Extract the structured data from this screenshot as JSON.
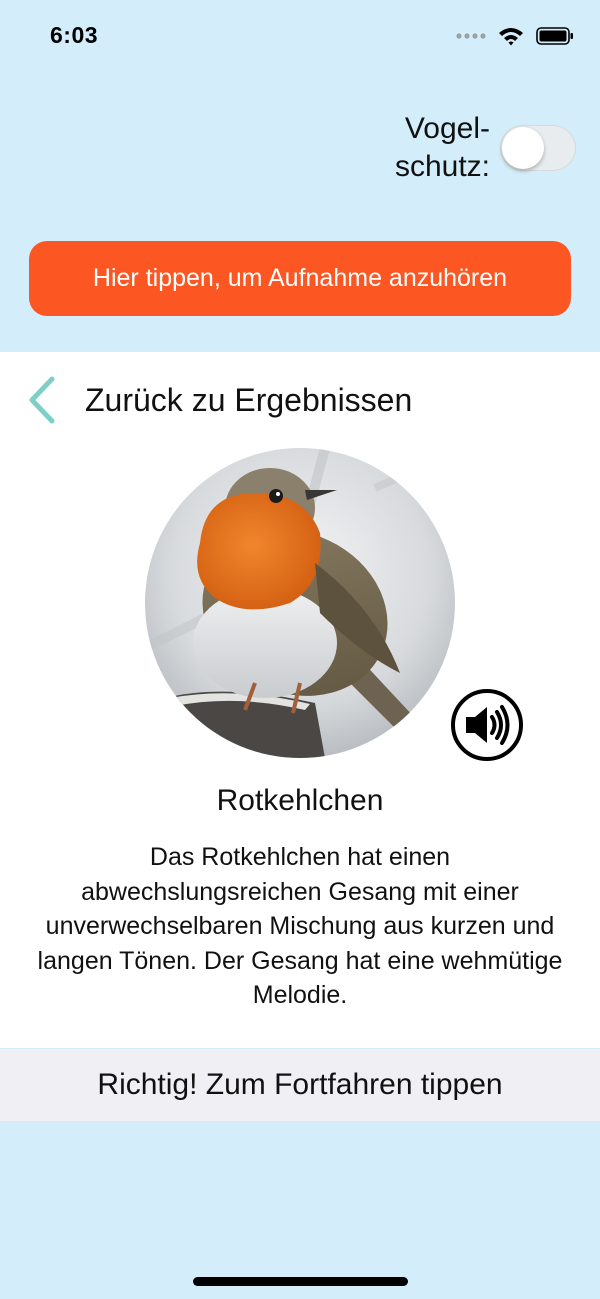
{
  "status": {
    "time": "6:03"
  },
  "settings": {
    "protection_label_line1": "Vogel-",
    "protection_label_line2": "schutz:",
    "protection_enabled": false
  },
  "player": {
    "record_label": "Hier tippen, um Aufnahme anzuhören"
  },
  "navigation": {
    "back_label": "Zurück zu Ergebnissen"
  },
  "bird": {
    "name": "Rotkehlchen",
    "description": "Das Rotkehlchen hat einen abwechslungsreichen Gesang mit einer unverwechselbaren Mischung aus kurzen und langen Tönen. Der Gesang hat eine wehmütige Melodie."
  },
  "footer": {
    "continue_label": "Richtig! Zum Fortfahren tippen"
  },
  "colors": {
    "background": "#d3eefa",
    "accent": "#fc5722",
    "back_chevron": "#7fcfc9",
    "footer_bg": "#efeff4"
  },
  "icons": {
    "back": "chevron-left-icon",
    "sound": "speaker-icon",
    "wifi": "wifi-icon",
    "battery": "battery-icon",
    "signal": "signal-dots-icon"
  }
}
